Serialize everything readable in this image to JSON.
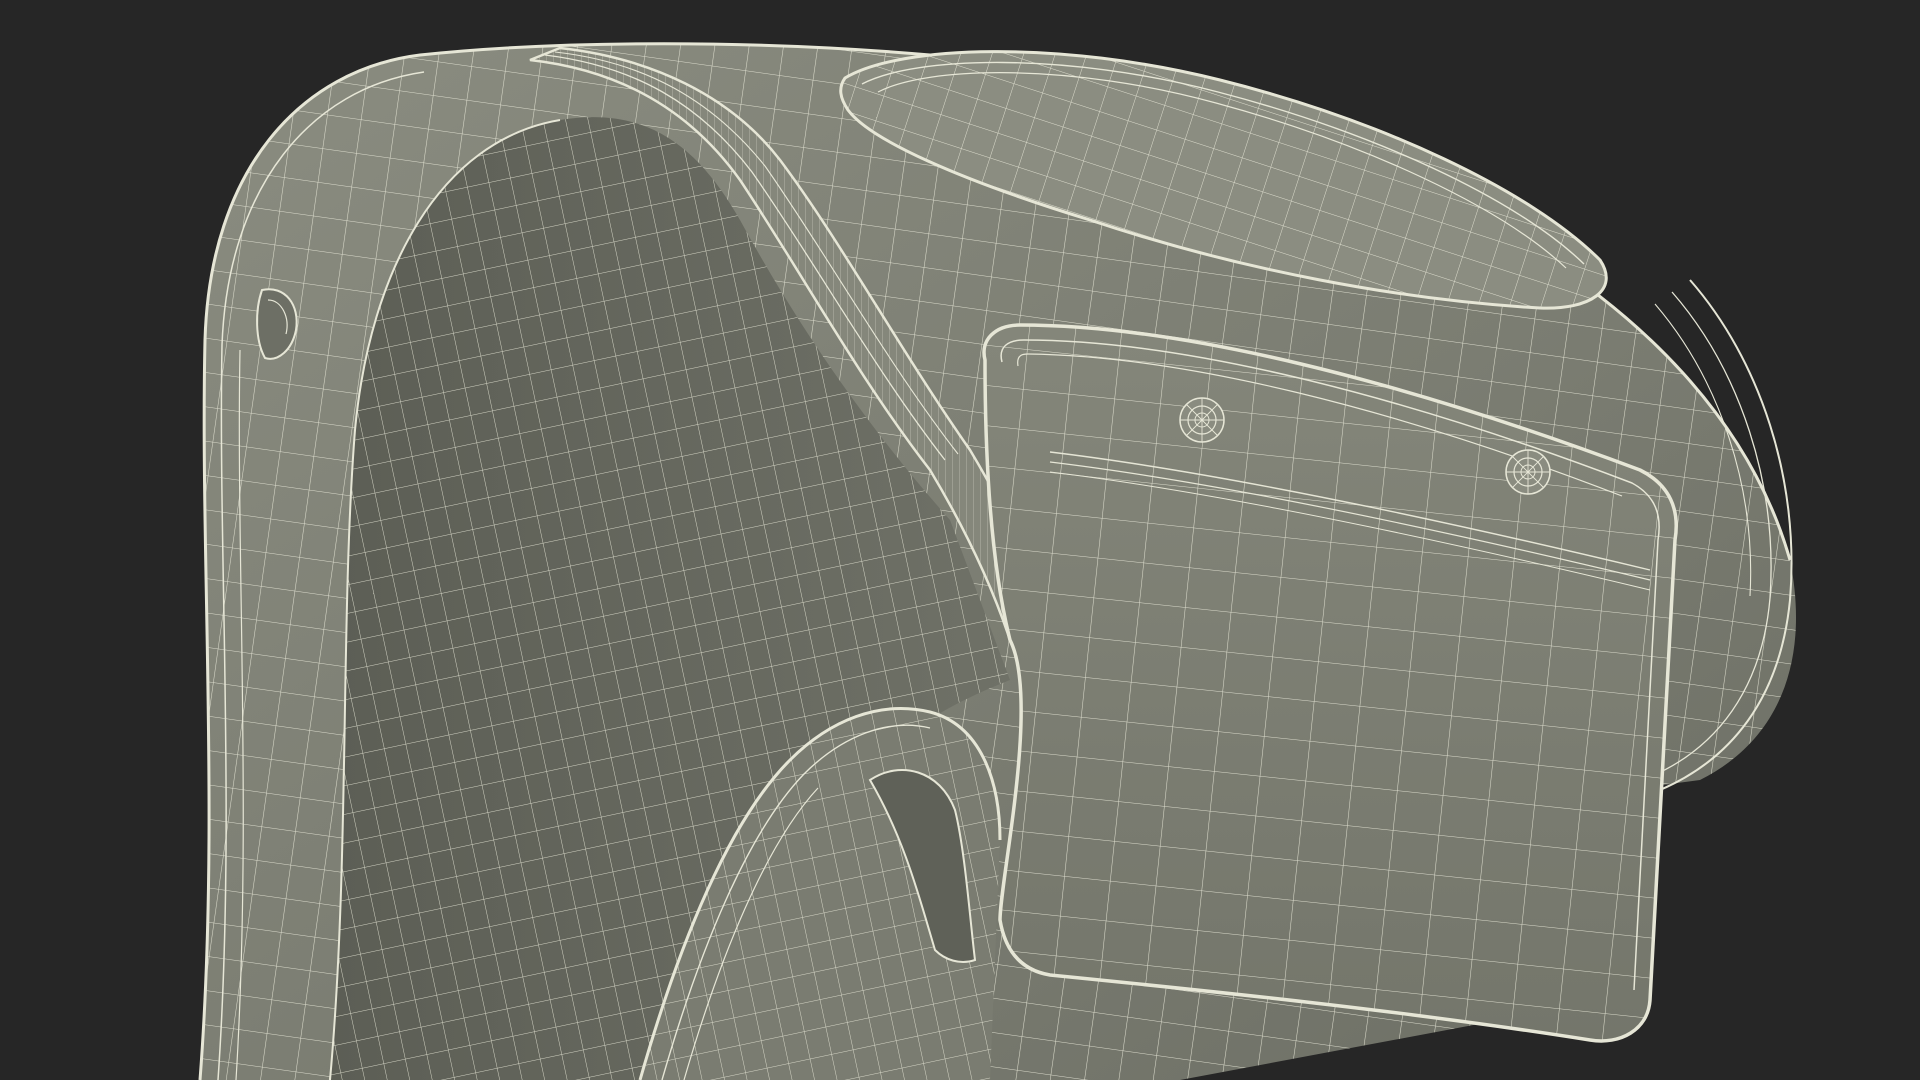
{
  "scene": {
    "background_color": "#262626",
    "surface_color": "#7b7d72",
    "surface_shadow_color": "#5d5f56",
    "surface_highlight_color": "#8a8c80",
    "wire_color": "#e6e6d6",
    "object": "wireframe-3d-model",
    "components": [
      "main-shell",
      "inner-shell",
      "top-cap",
      "front-pad",
      "rivet-left",
      "rivet-right",
      "lower-strap",
      "side-clip"
    ]
  }
}
